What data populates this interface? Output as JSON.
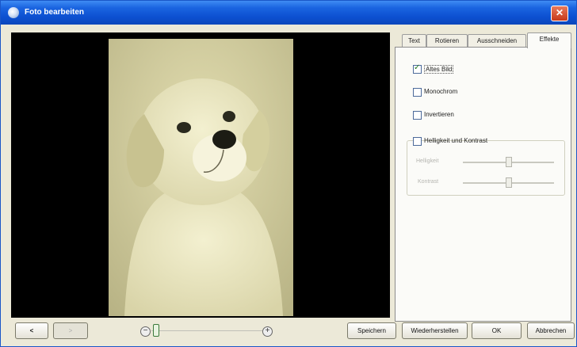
{
  "window": {
    "title": "Foto bearbeiten",
    "close_label": "✕"
  },
  "tabs": [
    {
      "label": "Text",
      "active": false
    },
    {
      "label": "Rotieren",
      "active": false
    },
    {
      "label": "Ausschneiden",
      "active": false
    },
    {
      "label": "Effekte",
      "active": true
    }
  ],
  "effects": {
    "altes_bild": {
      "label": "Altes Bild",
      "checked": true
    },
    "monochrom": {
      "label": "Monochrom",
      "checked": false
    },
    "invertieren": {
      "label": "Invertieren",
      "checked": false
    },
    "helligkeit_kontrast": {
      "label": "Helligkeit und Kontrast",
      "checked": false
    }
  },
  "sliders": {
    "helligkeit": {
      "label": "Helligkeit",
      "value": 0.5,
      "enabled": false
    },
    "kontrast": {
      "label": "Kontrast",
      "value": 0.5,
      "enabled": false
    }
  },
  "footer": {
    "back_symbol": "<",
    "forward_symbol": ">",
    "zoom_out_symbol": "−",
    "zoom_in_symbol": "+",
    "zoom_level": 0.0,
    "save_label": "Speichern",
    "restore_label": "Wiederherstellen",
    "ok_label": "OK",
    "cancel_label": "Abbrechen"
  },
  "colors": {
    "titlebar": "#0c4fd0",
    "photo_tint": "#d8d3a0",
    "frame": "#ece9d8"
  }
}
